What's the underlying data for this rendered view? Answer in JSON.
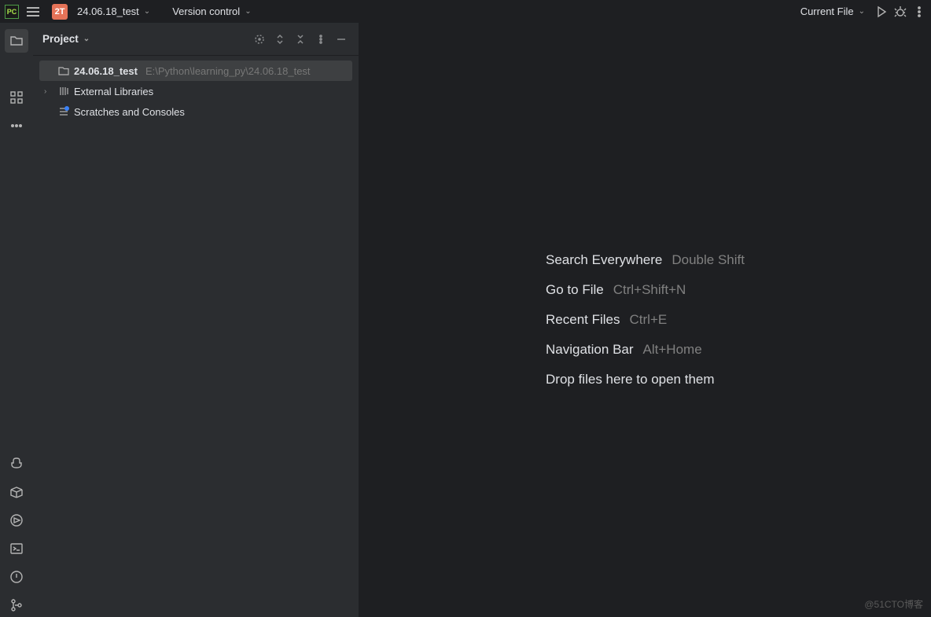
{
  "topbar": {
    "project_badge": "2T",
    "project_name": "24.06.18_test",
    "vcs_label": "Version control",
    "run_config": "Current File"
  },
  "panel": {
    "title": "Project",
    "root": {
      "name": "24.06.18_test",
      "path": "E:\\Python\\learning_py\\24.06.18_test"
    },
    "ext_lib": "External Libraries",
    "scratches": "Scratches and Consoles"
  },
  "tips": {
    "search": {
      "label": "Search Everywhere",
      "key": "Double Shift"
    },
    "gotofile": {
      "label": "Go to File",
      "key": "Ctrl+Shift+N"
    },
    "recent": {
      "label": "Recent Files",
      "key": "Ctrl+E"
    },
    "navbar": {
      "label": "Navigation Bar",
      "key": "Alt+Home"
    },
    "drop": {
      "label": "Drop files here to open them"
    }
  },
  "watermark": "@51CTO博客"
}
